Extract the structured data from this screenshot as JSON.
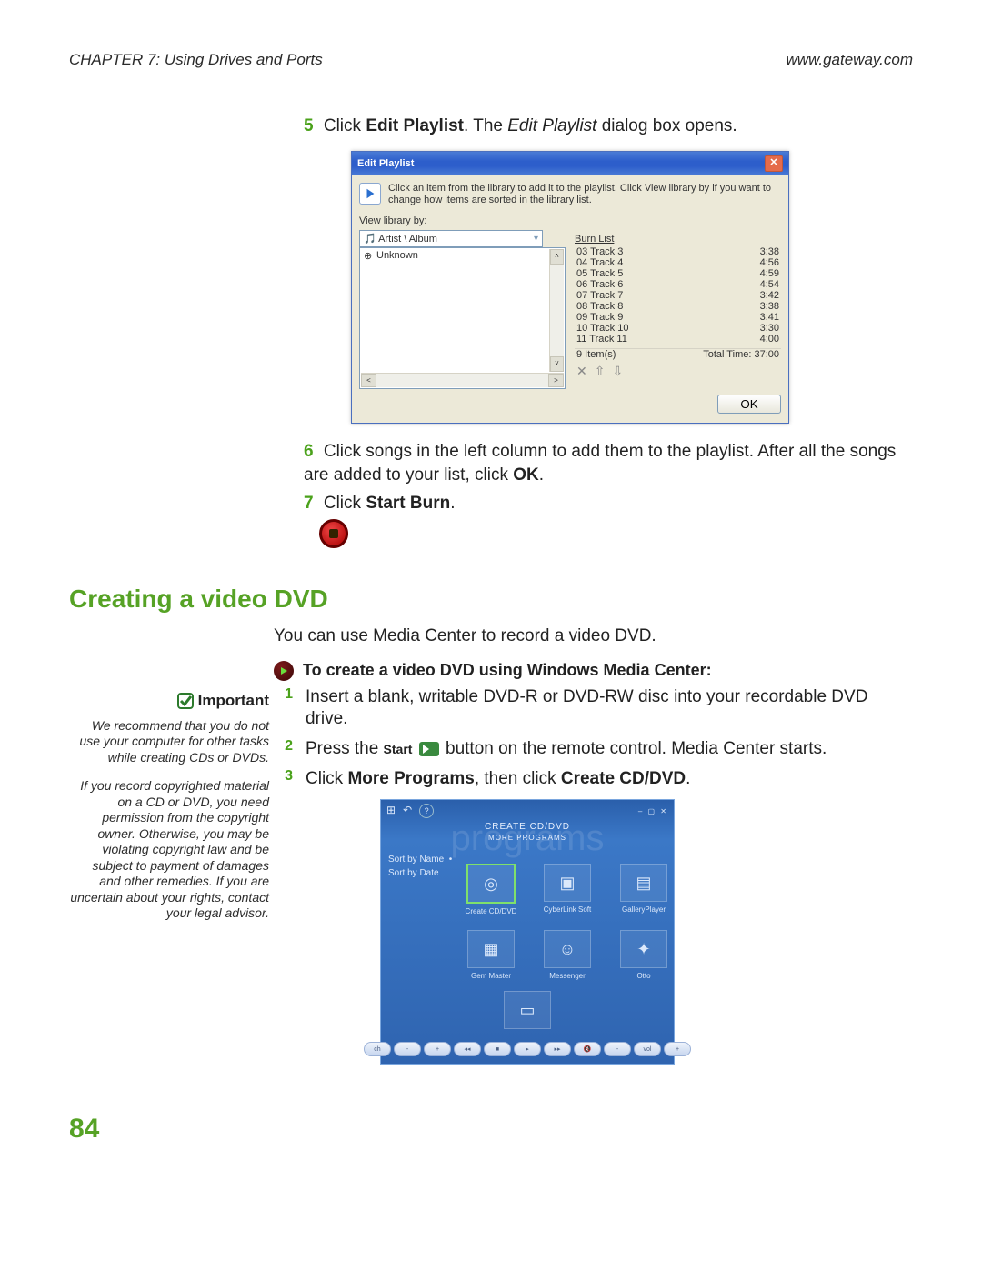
{
  "header": {
    "chapter": "CHAPTER 7: Using Drives and Ports",
    "url": "www.gateway.com"
  },
  "steps": {
    "s5_num": "5",
    "s5_a": "Click ",
    "s5_b": "Edit Playlist",
    "s5_c": ". The ",
    "s5_d": "Edit Playlist",
    "s5_e": " dialog box opens.",
    "s6_num": "6",
    "s6_a": "Click songs in the left column to add them to the playlist. After all the songs are added to your list, click ",
    "s6_b": "OK",
    "s6_c": ".",
    "s7_num": "7",
    "s7_a": "Click ",
    "s7_b": "Start Burn",
    "s7_c": "."
  },
  "dialog": {
    "title": "Edit Playlist",
    "hint": "Click an item from the library to add it to the playlist. Click View library by if you want to change how items are sorted in the library list.",
    "view_label": "View library by:",
    "combo_value": "Artist \\ Album",
    "left_item": "Unknown",
    "burn_list_label": "Burn List",
    "tracks": [
      {
        "n": "03 Track 3",
        "t": "3:38"
      },
      {
        "n": "04 Track 4",
        "t": "4:56"
      },
      {
        "n": "05 Track 5",
        "t": "4:59"
      },
      {
        "n": "06 Track 6",
        "t": "4:54"
      },
      {
        "n": "07 Track 7",
        "t": "3:42"
      },
      {
        "n": "08 Track 8",
        "t": "3:38"
      },
      {
        "n": "09 Track 9",
        "t": "3:41"
      },
      {
        "n": "10 Track 10",
        "t": "3:30"
      },
      {
        "n": "11 Track 11",
        "t": "4:00"
      }
    ],
    "items_label": "9 Item(s)",
    "total_label": "Total Time: 37:00",
    "ok_label": "OK"
  },
  "section": {
    "h": "Creating a video DVD",
    "intro": "You can use Media Center to record a video DVD.",
    "subhead": "To create a video DVD using Windows Media Center:"
  },
  "sidebar": {
    "head": "Important",
    "p1": "We recommend that you do not use your computer for other tasks while creating CDs or DVDs.",
    "p2": "If you record copyrighted material on a CD or DVD, you need permission from the copyright owner. Otherwise, you may be violating copyright law and be subject to payment of damages and other remedies. If you are uncertain about your rights, contact your legal advisor."
  },
  "dvd_steps": {
    "s1_num": "1",
    "s1": "Insert a blank, writable DVD-R or DVD-RW disc into your recordable DVD drive.",
    "s2_num": "2",
    "s2_a": "Press the ",
    "s2_b": "Start",
    "s2_c": " button on the remote control. Media Center starts.",
    "s3_num": "3",
    "s3_a": "Click ",
    "s3_b": "More Programs",
    "s3_c": ", then click ",
    "s3_d": "Create CD/DVD",
    "s3_e": "."
  },
  "mc": {
    "title_small": "CREATE CD/DVD",
    "subtitle": "MORE PROGRAMS",
    "watermark": "programs",
    "nav1": "Sort by Name",
    "nav2": "Sort by Date",
    "tiles": [
      {
        "label": "Create CD/DVD",
        "glyph": "◎"
      },
      {
        "label": "CyberLink Soft",
        "glyph": "▣"
      },
      {
        "label": "GalleryPlayer",
        "glyph": "▤"
      },
      {
        "label": "Gem Master",
        "glyph": "▦"
      },
      {
        "label": "Messenger",
        "glyph": "☺"
      },
      {
        "label": "Otto",
        "glyph": "✦"
      }
    ],
    "extra_tile_glyph": "▭",
    "controls": [
      "ch",
      "-",
      "+",
      "◂◂",
      "■",
      "▸",
      "▸▸",
      "🔇",
      "-",
      "vol",
      "+"
    ]
  },
  "page_number": "84"
}
